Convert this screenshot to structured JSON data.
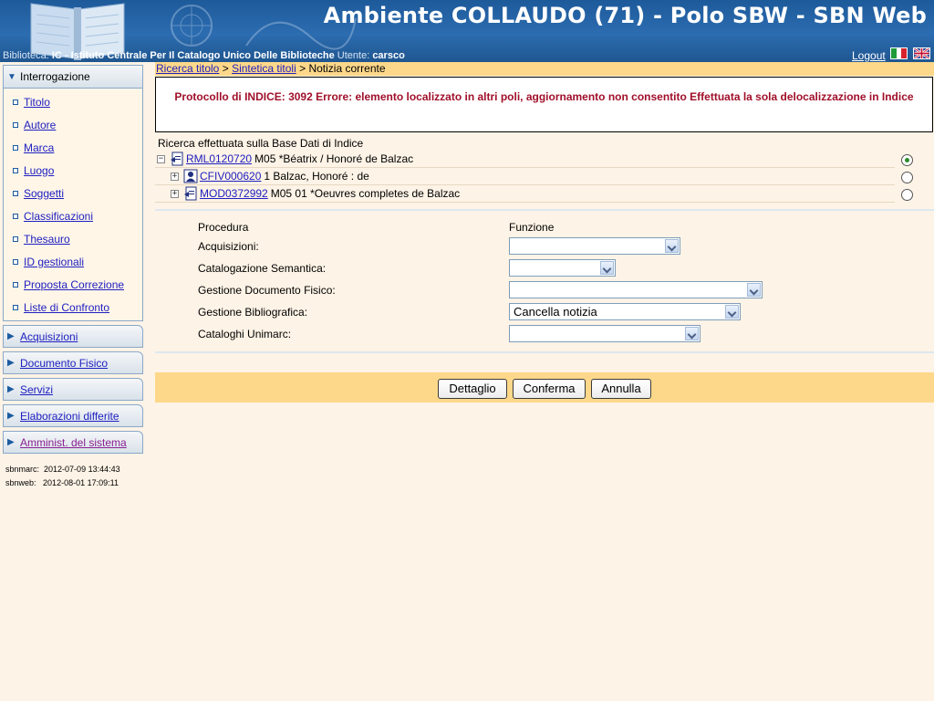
{
  "header": {
    "title": "Ambiente COLLAUDO (71) - Polo SBW - SBN Web",
    "biblioteca_label": "Biblioteca:",
    "biblioteca_value": "IC - Istituto Centrale Per Il Catalogo Unico Delle Biblioteche",
    "utente_label": "Utente:",
    "utente_value": "carsco",
    "logout": "Logout"
  },
  "sidebar": {
    "open_menu": "Interrogazione",
    "items": [
      "Titolo",
      "Autore",
      "Marca",
      "Luogo",
      "Soggetti",
      "Classificazioni",
      "Thesauro",
      "ID gestionali",
      "Proposta Correzione",
      "Liste di Confronto"
    ],
    "closed_menus": [
      "Acquisizioni",
      "Documento Fisico",
      "Servizi",
      "Elaborazioni differite",
      "Amminist. del sistema"
    ],
    "versions": [
      {
        "label": "sbnmarc:",
        "value": "2012-07-09 13:44:43"
      },
      {
        "label": "sbnweb:",
        "value": "2012-08-01 17:09:11"
      }
    ]
  },
  "breadcrumb": {
    "link1": "Ricerca titolo",
    "sep": ">",
    "link2": "Sintetica titoli",
    "current": "Notizia corrente"
  },
  "error": {
    "message": "Protocollo di INDICE: 3092 Errore: elemento localizzato in altri poli, aggiornamento non consentito Effettuata la sola delocalizzazione in Indice"
  },
  "search_base": "Ricerca effettuata sulla Base Dati di Indice",
  "tree": [
    {
      "expander": "−",
      "id": "RML0120720",
      "text": "M05 *Béatrix / Honoré de Balzac",
      "selected": true
    },
    {
      "expander": "+",
      "id": "CFIV000620",
      "text": "1 Balzac, Honoré : de",
      "selected": false
    },
    {
      "expander": "+",
      "id": "MOD0372992",
      "text": "M05 01 *Oeuvres completes de Balzac",
      "selected": false
    }
  ],
  "form": {
    "col_procedura": "Procedura",
    "col_funzione": "Funzione",
    "rows": [
      {
        "label": "Acquisizioni:",
        "value": ""
      },
      {
        "label": "Catalogazione Semantica:",
        "value": ""
      },
      {
        "label": "Gestione Documento Fisico:",
        "value": ""
      },
      {
        "label": "Gestione Bibliografica:",
        "value": "Cancella notizia"
      },
      {
        "label": "Cataloghi Unimarc:",
        "value": ""
      }
    ]
  },
  "buttons": {
    "dettaglio": "Dettaglio",
    "conferma": "Conferma",
    "annulla": "Annulla"
  },
  "colors": {
    "header_blue": "#2c6cb0",
    "bar_yellow": "#fed88a",
    "error_red": "#a0102a",
    "background": "#fdf3e6"
  }
}
